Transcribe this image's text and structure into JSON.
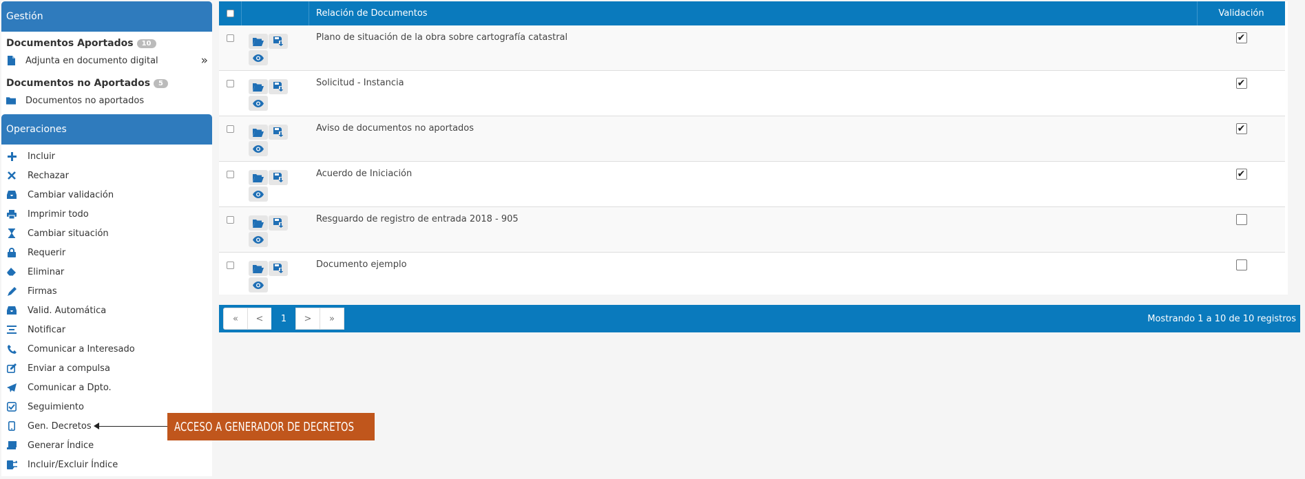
{
  "sidebar": {
    "gestion_title": "Gestión",
    "aportados": {
      "title": "Documentos Aportados",
      "count": "10",
      "item": "Adjunta en documento digital"
    },
    "no_aportados": {
      "title": "Documentos no Aportados",
      "count": "5",
      "item": "Documentos no aportados"
    },
    "operaciones_title": "Operaciones",
    "operations": [
      {
        "label": "Incluir",
        "icon": "plus-icon"
      },
      {
        "label": "Rechazar",
        "icon": "times-icon"
      },
      {
        "label": "Cambiar validación",
        "icon": "inbox-icon"
      },
      {
        "label": "Imprimir todo",
        "icon": "print-icon"
      },
      {
        "label": "Cambiar situación",
        "icon": "hourglass-icon"
      },
      {
        "label": "Requerir",
        "icon": "lock-icon"
      },
      {
        "label": "Eliminar",
        "icon": "eraser-icon"
      },
      {
        "label": "Firmas",
        "icon": "pencil-icon"
      },
      {
        "label": "Valid. Automática",
        "icon": "inbox-icon"
      },
      {
        "label": "Notificar",
        "icon": "align-center-icon"
      },
      {
        "label": "Comunicar a Interesado",
        "icon": "phone-icon"
      },
      {
        "label": "Enviar a compulsa",
        "icon": "edit-icon"
      },
      {
        "label": "Comunicar a Dpto.",
        "icon": "paper-plane-icon"
      },
      {
        "label": "Seguimiento",
        "icon": "check-square-icon"
      },
      {
        "label": "Gen. Decretos",
        "icon": "tablet-icon"
      },
      {
        "label": "Generar Índice",
        "icon": "book-icon"
      },
      {
        "label": "Incluir/Excluir Índice",
        "icon": "exchange-icon"
      }
    ]
  },
  "table": {
    "col_relacion": "Relación de Documentos",
    "col_validacion": "Validación",
    "rows": [
      {
        "name": "Plano de situación de la obra sobre cartografía catastral",
        "validated": true
      },
      {
        "name": "Solicitud - Instancia",
        "validated": true
      },
      {
        "name": "Aviso de documentos no aportados",
        "validated": true
      },
      {
        "name": "Acuerdo de Iniciación",
        "validated": true
      },
      {
        "name": "Resguardo de registro de entrada 2018 - 905",
        "validated": false
      },
      {
        "name": "Documento ejemplo",
        "validated": false
      }
    ]
  },
  "pager": {
    "first": "«",
    "prev": "<",
    "page": "1",
    "next": ">",
    "last": "»",
    "info": "Mostrando 1 a 10 de 10 registros"
  },
  "annotation": {
    "text": "ACCESO A GENERADOR DE DECRETOS"
  },
  "colors": {
    "primary": "#0a7abd",
    "sidebar_header": "#2f7bbd",
    "icon": "#1f6fb5",
    "callout": "#c0561c"
  }
}
